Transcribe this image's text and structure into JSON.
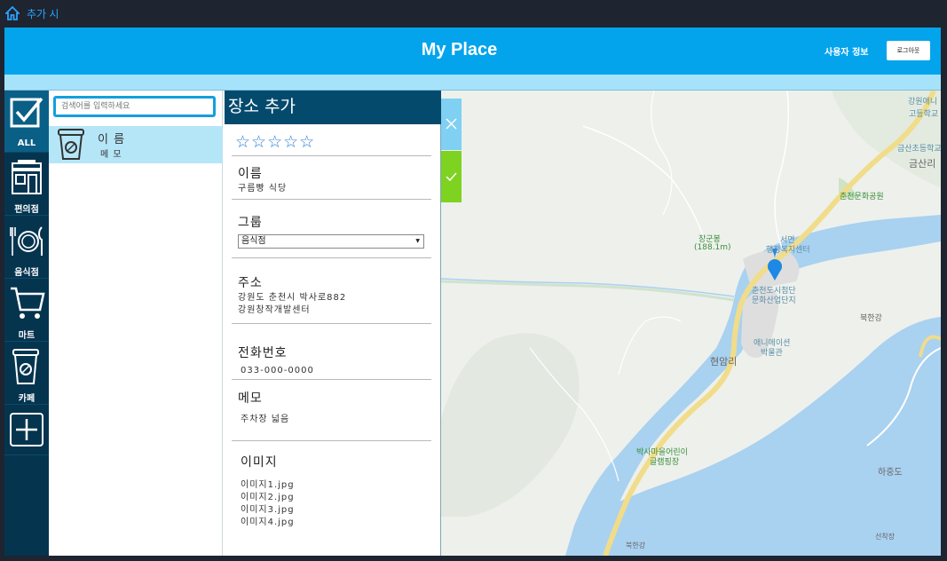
{
  "window": {
    "title": "추가 시"
  },
  "header": {
    "app_title": "My Place",
    "user_info": "사용자 정보",
    "logout": "로그아웃"
  },
  "categories": [
    {
      "label": "ALL",
      "icon": "checkbox-icon"
    },
    {
      "label": "편의점",
      "icon": "store-icon"
    },
    {
      "label": "음식점",
      "icon": "utensils-icon"
    },
    {
      "label": "마트",
      "icon": "cart-icon"
    },
    {
      "label": "카페",
      "icon": "coffee-cup-icon"
    },
    {
      "label": "",
      "icon": "add-icon"
    }
  ],
  "list": {
    "search_placeholder": "검색어를 입력하세요",
    "items": [
      {
        "name": "이 름",
        "memo": "메 모"
      }
    ]
  },
  "form": {
    "title": "장소 추가",
    "stars": "☆☆☆☆☆",
    "name_label": "이름",
    "name_value": "구름빵 식당",
    "group_label": "그룹",
    "group_value": "음식점",
    "address_label": "주소",
    "address_line1": "강원도 춘천시 박사로882",
    "address_line2": "강원창작개발센터",
    "phone_label": "전화번호",
    "phone_value": "033-000-0000",
    "memo_label": "메모",
    "memo_value": "주차장 넓음",
    "image_label": "이미지",
    "images": [
      "이미지1.jpg",
      "이미지2.jpg",
      "이미지3.jpg",
      "이미지4.jpg"
    ]
  },
  "map": {
    "labels": {
      "school1": "강원애니",
      "school2": "고등학교",
      "school3": "금산초등학교",
      "area1": "금산리",
      "park": "춘천문화공원",
      "mountain1": "장군봉",
      "mountain2": "(188.1m)",
      "office1": "서면",
      "office2": "행정복지센터",
      "complex1": "춘천도시첨단",
      "complex2": "문화산업단지",
      "river1": "북한강",
      "museum1": "애니메이션",
      "museum2": "박물관",
      "village": "현암리",
      "park2a": "박사마을어린이",
      "park2b": "글램핑장",
      "island": "하중도",
      "river2": "북한강",
      "dock": "선착장"
    }
  },
  "colors": {
    "header": "#03a4ec",
    "sidebar": "#05344f",
    "accent": "#149fde",
    "confirm": "#7ed321"
  }
}
